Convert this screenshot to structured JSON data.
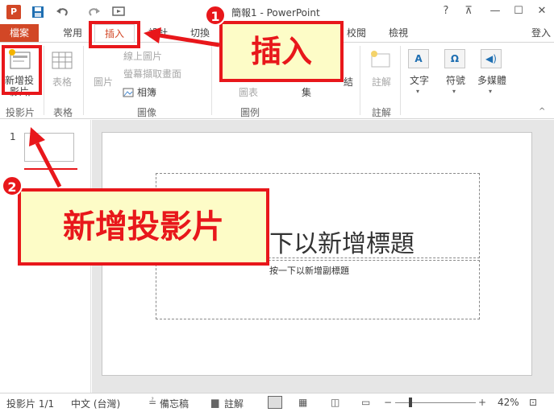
{
  "titlebar": {
    "app_icon": "P",
    "title": "簡報1 - PowerPoint",
    "help": "?",
    "login": "登入"
  },
  "tabs": [
    "檔案",
    "常用",
    "插入",
    "設計",
    "切換",
    "校閱",
    "檢視"
  ],
  "ribbon": {
    "new_slide": "新增投\n影片",
    "table": "表格",
    "picture": "圖片",
    "online_picture": "線上圖片",
    "screenshot": "螢幕擷取畫面",
    "album": "相簿",
    "shapes": "圖表",
    "comment": "註解",
    "text": "文字",
    "symbol": "符號",
    "media": "多媒體",
    "group_slides": "投影片",
    "group_tables": "表格",
    "group_images": "圖像",
    "group_illustrations": "圖例",
    "group_comments": "註解",
    "partial_1": "集",
    "partial_2": "結"
  },
  "slide": {
    "title_placeholder": "下以新增標題",
    "subtitle_placeholder": "按一下以新增副標題"
  },
  "thumbs": {
    "index": "1"
  },
  "status": {
    "slide_count": "投影片 1/1",
    "language": "中文 (台灣)",
    "notes": "備忘稿",
    "comments": "註解",
    "zoom": "42%"
  },
  "annotations": {
    "badge_1": "1",
    "badge_2": "2",
    "callout_insert": "插入",
    "callout_new_slide": "新增投影片"
  },
  "colors": {
    "accent": "#d24726",
    "annotation_red": "#e8171b",
    "callout_fill": "#fdfcc7"
  }
}
